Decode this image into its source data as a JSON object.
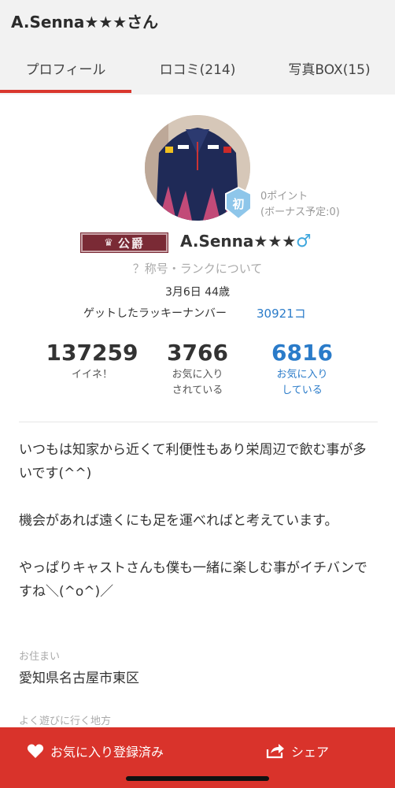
{
  "header": {
    "title": "A.Senna★★★さん"
  },
  "tabs": [
    {
      "label": "プロフィール",
      "active": true
    },
    {
      "label": "ロコミ(214)"
    },
    {
      "label": "写真BOX(15)"
    }
  ],
  "profile": {
    "badge_text": "初",
    "points_line1": "0ポイント",
    "points_line2": "(ボーナス予定:0)",
    "title_crown": "♛",
    "title_text": "公爵",
    "username": "A.Senna★★★",
    "gender_symbol": "♂",
    "rank_link": "？称号・ランクについて",
    "birth": "3月6日 44歳",
    "lucky_label": "ゲットしたラッキーナンバー",
    "lucky_number": "30921コ"
  },
  "stats": [
    {
      "value": "137259",
      "label1": "イイネ！",
      "label2": ""
    },
    {
      "value": "3766",
      "label1": "お気に入り",
      "label2": "されている"
    },
    {
      "value": "6816",
      "label1": "お気に入り",
      "label2": "している"
    }
  ],
  "bio": {
    "p1": "いつもは知家から近くて利便性もあり栄周辺で飲む事が多いです(^^)",
    "p2": "機会があれば遠くにも足を運べればと考えています。",
    "p3": "やっぱりキャストさんも僕も一緒に楽しむ事がイチバンですね＼(^o^)／"
  },
  "fields": {
    "residence_label": "お住まい",
    "residence_value": "愛知県名古屋市東区",
    "area_label": "よく遊びに行く地方"
  },
  "footer": {
    "favorite_label": "お気に入り登録済み",
    "share_label": "シェア"
  },
  "colors": {
    "accent": "#d9332b",
    "link": "#2a7bc9",
    "male": "#3fa7dd"
  }
}
